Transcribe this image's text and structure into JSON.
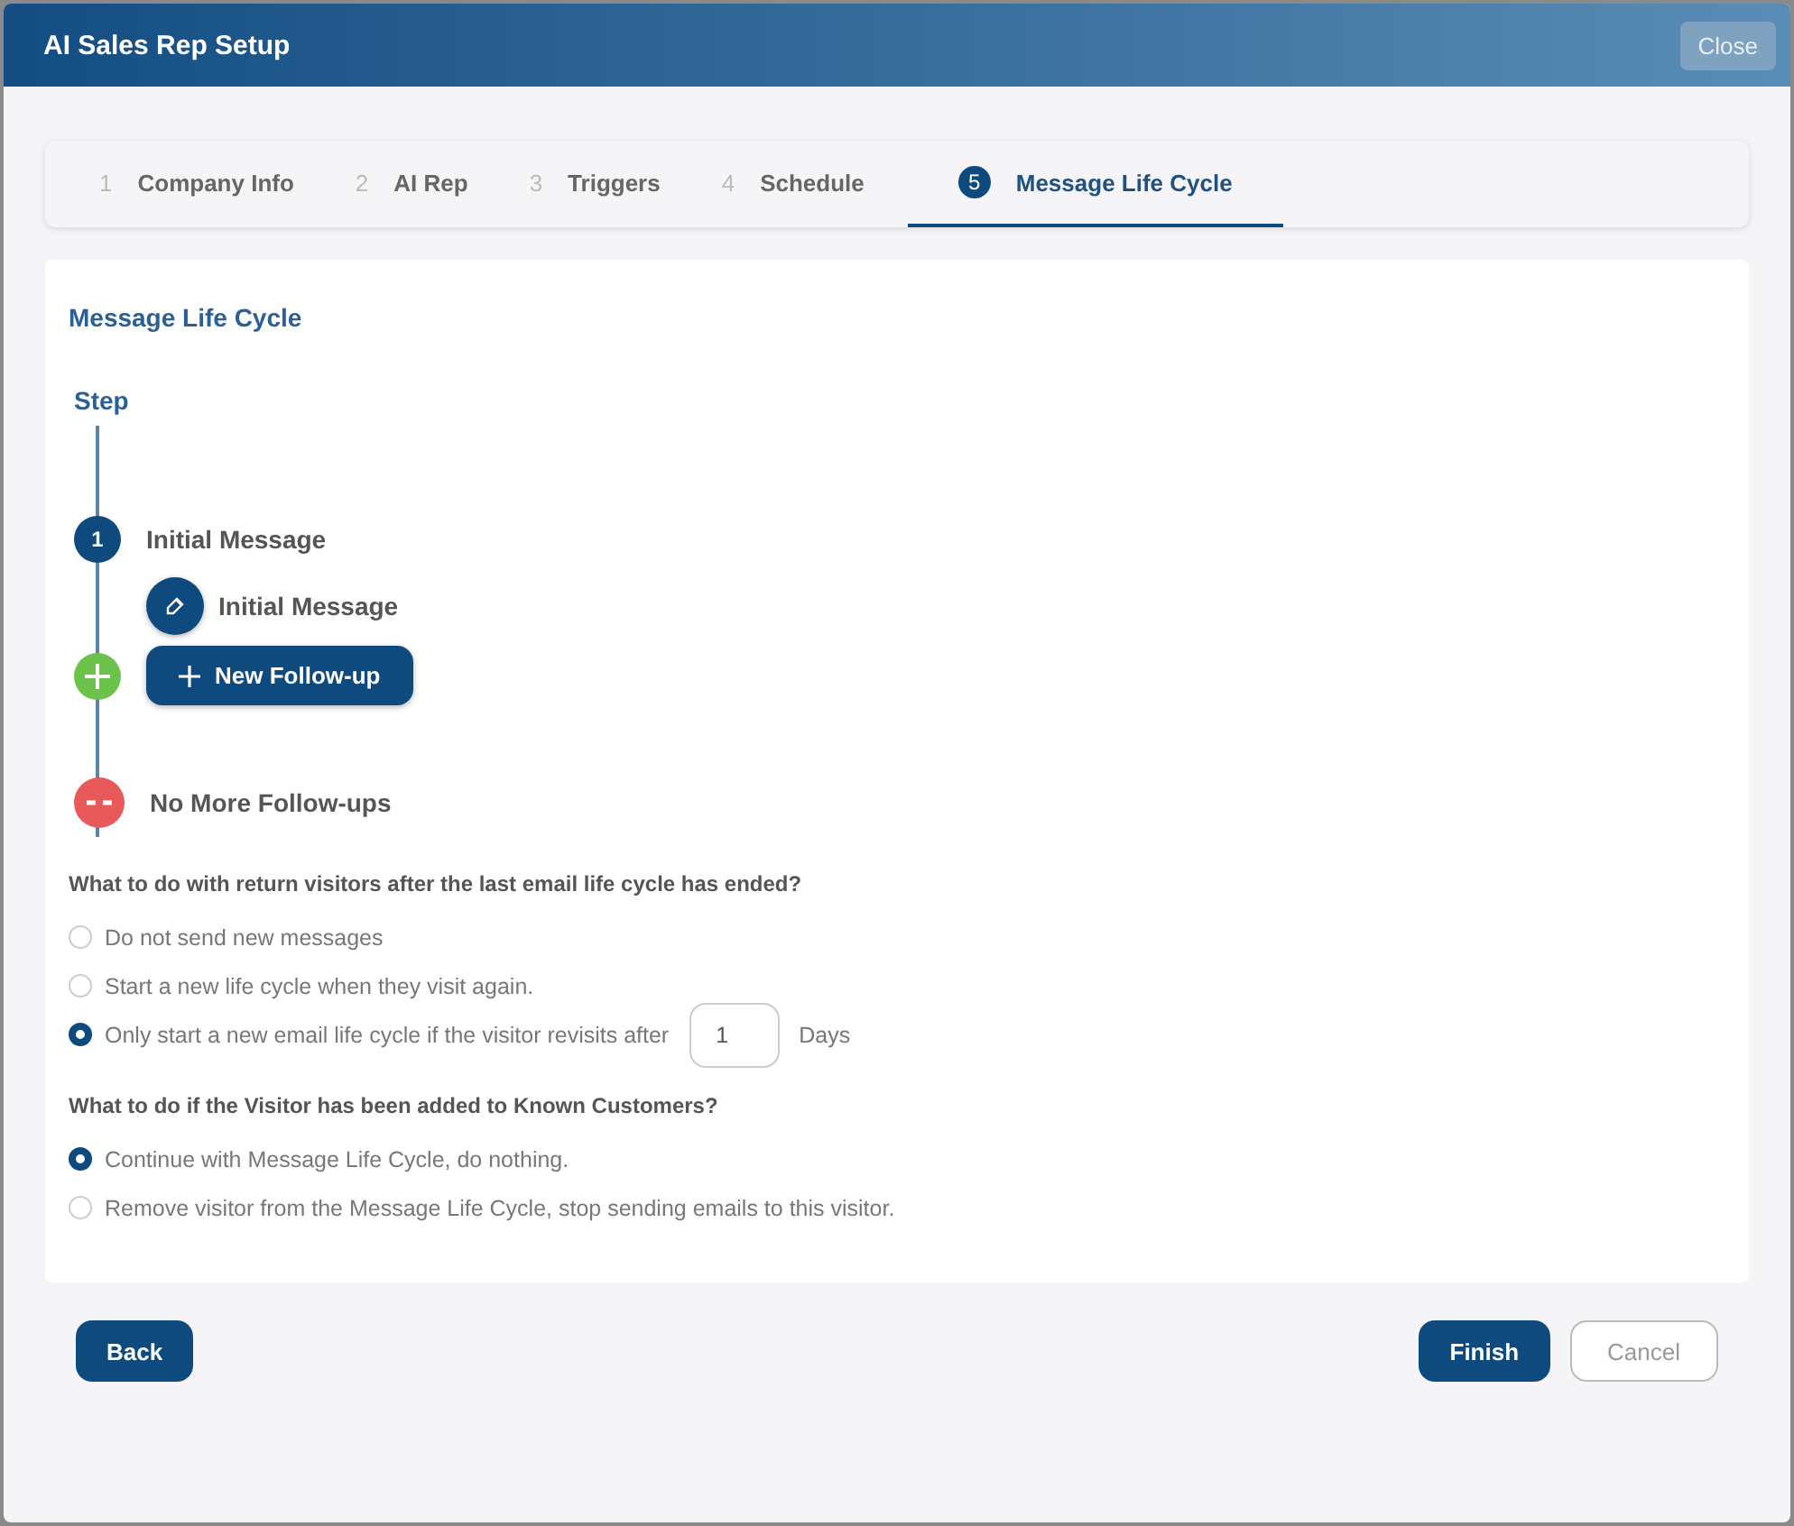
{
  "window": {
    "title": "AI Sales Rep Setup",
    "close_button": "Close"
  },
  "tabs": [
    {
      "number": "1",
      "label": "Company Info",
      "selected": false
    },
    {
      "number": "2",
      "label": "AI Rep",
      "selected": false
    },
    {
      "number": "3",
      "label": "Triggers",
      "selected": false
    },
    {
      "number": "4",
      "label": "Schedule",
      "selected": false
    },
    {
      "number": "5",
      "label": "Message Life Cycle",
      "selected": true
    }
  ],
  "section_title": "Message Life Cycle",
  "timeline": {
    "header": "Step",
    "steps": [
      {
        "number": "1",
        "title": "Initial Message",
        "items": [
          {
            "label": "Initial Message"
          }
        ]
      }
    ],
    "add_button": "New Follow-up",
    "end_label": "No More Follow-ups"
  },
  "questions": [
    {
      "text": "What to do with return visitors after the last email life cycle has ended?",
      "options": [
        {
          "label": "Do not send new messages",
          "selected": false
        },
        {
          "label": "Start a new life cycle when they visit again.",
          "selected": false
        },
        {
          "label": "Only start a new email life cycle if the visitor revisits after",
          "selected": true,
          "value": "1",
          "suffix": "Days"
        }
      ]
    },
    {
      "text": "What to do if the Visitor has been added to Known Customers?",
      "options": [
        {
          "label": "Continue with Message Life Cycle, do nothing.",
          "selected": true
        },
        {
          "label": "Remove visitor from the Message Life Cycle, stop sending emails to this visitor.",
          "selected": false
        }
      ]
    }
  ],
  "footer": {
    "left_buttons": [
      {
        "label": "Back",
        "kind": "primary"
      }
    ],
    "right_buttons": [
      {
        "label": "Finish",
        "kind": "primary"
      },
      {
        "label": "Cancel",
        "kind": "outline"
      }
    ]
  }
}
